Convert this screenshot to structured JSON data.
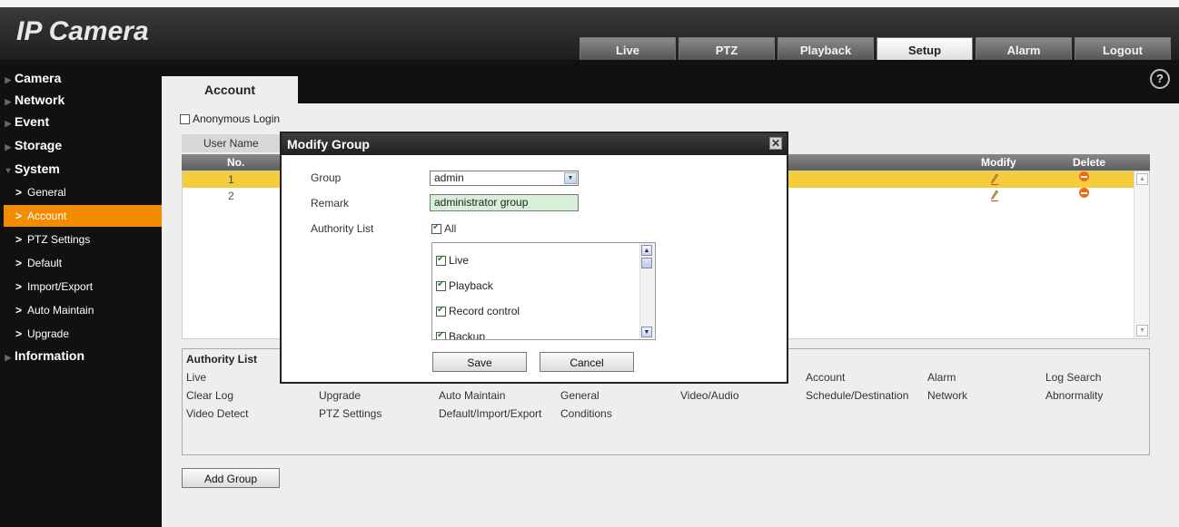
{
  "app": {
    "logo_ip": "IP",
    "logo_rest": " Camera"
  },
  "topnav": {
    "tabs": [
      {
        "label": "Live"
      },
      {
        "label": "PTZ"
      },
      {
        "label": "Playback"
      },
      {
        "label": "Setup",
        "active": true
      },
      {
        "label": "Alarm"
      },
      {
        "label": "Logout"
      }
    ]
  },
  "sidebar": {
    "sections": [
      {
        "label": "Camera"
      },
      {
        "label": "Network"
      },
      {
        "label": "Event"
      },
      {
        "label": "Storage"
      },
      {
        "label": "System",
        "expanded": true
      },
      {
        "label": "Information"
      }
    ],
    "system_items": [
      {
        "label": "General"
      },
      {
        "label": "Account",
        "active": true
      },
      {
        "label": "PTZ Settings"
      },
      {
        "label": "Default"
      },
      {
        "label": "Import/Export"
      },
      {
        "label": "Auto Maintain"
      },
      {
        "label": "Upgrade"
      }
    ]
  },
  "page": {
    "tab_label": "Account",
    "help_glyph": "?",
    "anonymous_login_label": "Anonymous Login",
    "user_tab_label": "User Name",
    "table": {
      "headers": {
        "no": "No.",
        "modify": "Modify",
        "delete": "Delete"
      },
      "rows": [
        {
          "no": "1",
          "selected": true
        },
        {
          "no": "2"
        }
      ]
    },
    "authority_list": {
      "title": "Authority List",
      "rows": [
        [
          "Live",
          "",
          "",
          "",
          "",
          "Account",
          "Alarm",
          "Log Search"
        ],
        [
          "Clear Log",
          "Upgrade",
          "Auto Maintain",
          "General",
          "Video/Audio",
          "Schedule/Destination",
          "Network",
          "Abnormality"
        ],
        [
          "Video Detect",
          "PTZ Settings",
          "Default/Import/Export",
          "Conditions",
          "",
          "",
          "",
          ""
        ]
      ]
    },
    "add_group_label": "Add Group"
  },
  "modal": {
    "title": "Modify Group",
    "close_glyph": "✕",
    "group_label": "Group",
    "group_value": "admin",
    "remark_label": "Remark",
    "remark_value": "administrator group",
    "authority_label": "Authority List",
    "all_label": "All",
    "all_checked": true,
    "authorities": [
      {
        "label": "Live",
        "checked": true
      },
      {
        "label": "Playback",
        "checked": true
      },
      {
        "label": "Record control",
        "checked": true
      },
      {
        "label": "Backup",
        "checked": true
      }
    ],
    "save_label": "Save",
    "cancel_label": "Cancel"
  },
  "colors": {
    "accent": "#f28c00",
    "selected_row": "#f5cc3a",
    "header_dark": "#1e1e1e"
  }
}
